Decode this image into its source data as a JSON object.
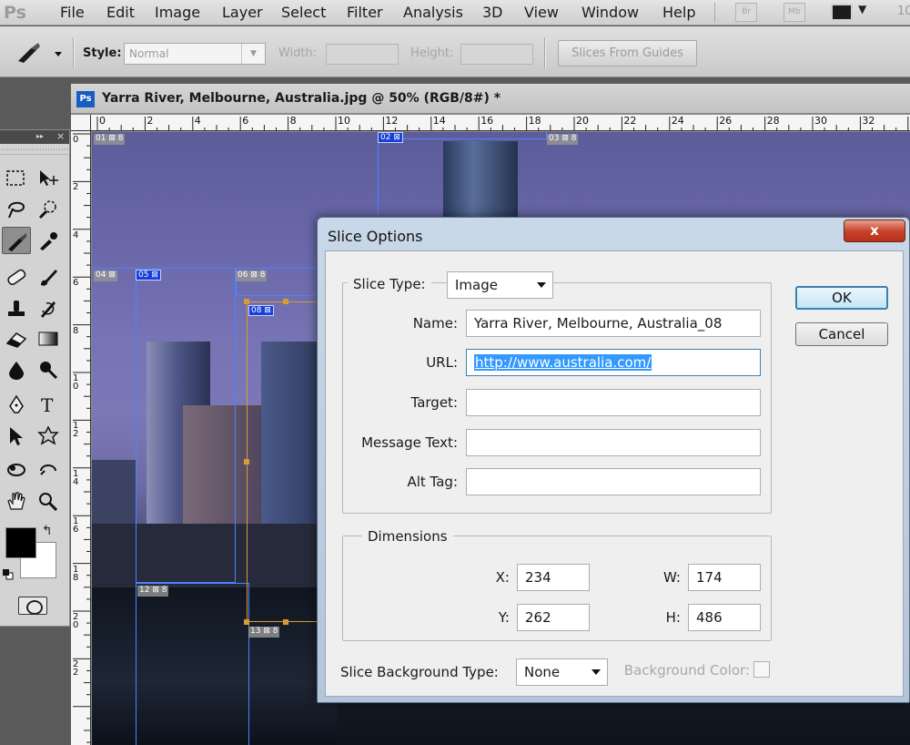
{
  "app": {
    "logo": "Ps"
  },
  "menu": {
    "items": [
      "File",
      "Edit",
      "Image",
      "Layer",
      "Select",
      "Filter",
      "Analysis",
      "3D",
      "View",
      "Window",
      "Help"
    ],
    "bridge": "Br",
    "mini_bridge": "Mb",
    "zoom": "10"
  },
  "options": {
    "style_label": "Style:",
    "style_value": "Normal",
    "width_label": "Width:",
    "height_label": "Height:",
    "slices_from_guides": "Slices From Guides"
  },
  "document": {
    "icon": "Ps",
    "title": "Yarra River, Melbourne, Australia.jpg @ 50% (RGB/8#) *",
    "ruler_h": [
      "0",
      "2",
      "4",
      "6",
      "8",
      "10",
      "12",
      "14",
      "16",
      "18",
      "20",
      "22",
      "24",
      "26",
      "28",
      "30",
      "32"
    ],
    "ruler_v": [
      "0",
      "2",
      "4",
      "6",
      "8",
      "10",
      "12",
      "14",
      "16",
      "18",
      "20",
      "22"
    ],
    "slices": [
      "01",
      "02",
      "03",
      "04",
      "05",
      "06",
      "08",
      "12",
      "13"
    ]
  },
  "dialog": {
    "title": "Slice Options",
    "close": "x",
    "slice_type_label": "Slice Type:",
    "slice_type_value": "Image",
    "name_label": "Name:",
    "name_value": "Yarra River, Melbourne, Australia_08",
    "url_label": "URL:",
    "url_value": "http://www.australia.com/",
    "target_label": "Target:",
    "target_value": "",
    "message_label": "Message Text:",
    "message_value": "",
    "alt_label": "Alt Tag:",
    "alt_value": "",
    "dimensions_title": "Dimensions",
    "x_label": "X:",
    "x_value": "234",
    "y_label": "Y:",
    "y_value": "262",
    "w_label": "W:",
    "w_value": "174",
    "h_label": "H:",
    "h_value": "486",
    "bg_type_label": "Slice Background Type:",
    "bg_type_value": "None",
    "bg_color_label": "Background Color:",
    "ok": "OK",
    "cancel": "Cancel"
  }
}
